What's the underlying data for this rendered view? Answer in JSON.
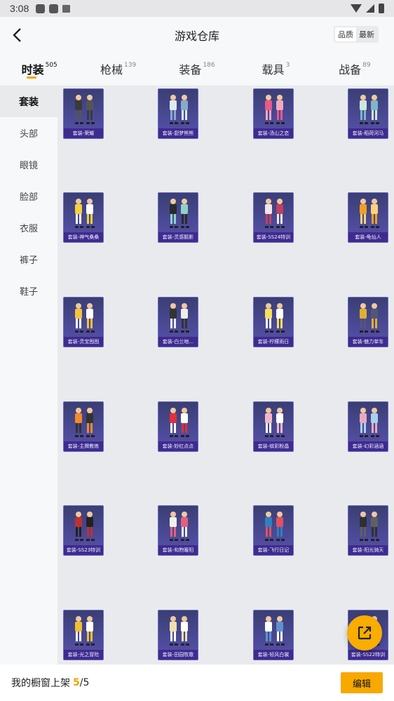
{
  "status_bar": {
    "time": "3:08"
  },
  "header": {
    "title": "游戏仓库",
    "sort_options": [
      "品质",
      "最新"
    ]
  },
  "tabs": [
    {
      "label": "时装",
      "count": "505"
    },
    {
      "label": "枪械",
      "count": "139"
    },
    {
      "label": "装备",
      "count": "186"
    },
    {
      "label": "载具",
      "count": "3"
    },
    {
      "label": "战备",
      "count": "89"
    }
  ],
  "sidebar": {
    "items": [
      "套装",
      "头部",
      "眼镜",
      "脸部",
      "衣服",
      "裤子",
      "鞋子"
    ]
  },
  "items": [
    "套装-荣耀",
    "套装-厨梦熊熊",
    "套装-汤山之恋",
    "套装-稻荷河马",
    "套装-神气桑桑",
    "套装-灵感鹅影",
    "套装-SS24特训",
    "套装-龟仙人",
    "套装-灵宝囤囤",
    "套装-白兰地...",
    "套装-柠檬雨日",
    "套装-魅力单车",
    "套装-主牌教练",
    "套装-妙红点点",
    "套装-缤彩粉晶",
    "套装-幻彩涵涵",
    "套装-SS23特训",
    "套装-和煦暖阳",
    "套装-飞行日记",
    "套装-阳光骑天",
    "套装-光之冒险",
    "套装-田园牧歌",
    "套装-轻风白裳",
    "套装-SS22特训"
  ],
  "footer": {
    "label": "我的橱窗上架",
    "current": "5",
    "separator": "/",
    "total": "5",
    "edit_label": "编辑"
  },
  "colors": {
    "accent": "#f7a900",
    "card_bg": "#4b4a97"
  }
}
